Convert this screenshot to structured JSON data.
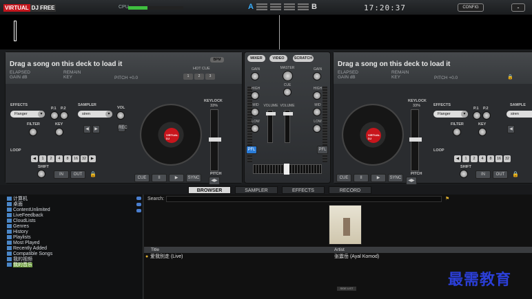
{
  "topbar": {
    "logo_a": "VIRTUAL",
    "logo_b": "DJ FREE",
    "cpu_label": "CPU",
    "cpu_level": 0.35,
    "deck_a": "A",
    "deck_b": "B",
    "clock": "17:20:37",
    "config": "CONFIG",
    "minimize": "-"
  },
  "deck_left": {
    "title": "Drag a song on this deck to load it",
    "elapsed": "ELAPSED",
    "remain": "REMAIN",
    "gain": "GAIN dB",
    "key": "KEY",
    "pitch": "PITCH +0.0",
    "bpm": "BPM",
    "hotcue": "HOT CUE",
    "hotcues": [
      "1",
      "2",
      "3"
    ],
    "effects": "EFFECTS",
    "effect_value": "Flanger",
    "p1": "P.1",
    "p2": "P.2",
    "sampler": "SAMPLER",
    "sampler_value": "siren",
    "vol": "VOL",
    "filter": "FILTER",
    "key2": "KEY",
    "rec": "REC",
    "loop": "LOOP",
    "loops": [
      "1",
      "2",
      "4",
      "8",
      "16",
      "32"
    ],
    "shift": "SHIFT",
    "in": "IN",
    "out": "OUT",
    "keylock": "KEYLOCK",
    "keylock_pct": "33%",
    "pitch_lbl": "PITCH",
    "cue": "CUE",
    "pause": "II",
    "play": "▶",
    "sync": "SYNC",
    "label_text": "VIRTUAL DJ"
  },
  "deck_right": {
    "title": "Drag a song on this deck to load it",
    "elapsed": "ELAPSED",
    "remain": "REMAIN",
    "gain": "GAIN dB",
    "key": "KEY",
    "pitch": "PITCH +0.0",
    "effects": "EFFECTS",
    "effect_value": "Flanger",
    "p1": "P.1",
    "p2": "P.2",
    "sampler": "SAMPLE",
    "sampler_value": "siren",
    "filter": "FILTER",
    "key2": "KEY",
    "loop": "LOOP",
    "loops": [
      "1",
      "2",
      "4",
      "8",
      "16",
      "32"
    ],
    "shift": "SHIFT",
    "in": "IN",
    "out": "OUT",
    "keylock": "KEYLOCK",
    "keylock_pct": "33%",
    "pitch_lbl": "PITCH",
    "cue": "CUE",
    "pause": "II",
    "play": "▶",
    "sync": "SYNC",
    "label_text": "VIRTUAL DJ"
  },
  "mixer": {
    "tabs": [
      "MIXER",
      "VIDEO",
      "SCRATCH"
    ],
    "gain": "GAIN",
    "master": "MASTER",
    "cue": "CUE",
    "high": "HIGH",
    "mid": "MID",
    "low": "LOW",
    "volume": "VOLUME",
    "pfl": "PFL"
  },
  "browser_tabs": [
    "BROWSER",
    "SAMPLER",
    "EFFECTS",
    "RECORD"
  ],
  "tree": [
    "计算机",
    "桌面",
    "ContentUnlimited",
    "LiveFeedback",
    "CloudLists",
    "Genres",
    "History",
    "Playlists",
    "Most Played",
    "Recently Added",
    "Compatible Songs",
    "我的视频",
    "我的音乐"
  ],
  "search": {
    "label": "Search:",
    "value": ""
  },
  "columns": {
    "title": "Title",
    "artist": "Artist"
  },
  "tracks": [
    {
      "title": "爱我别走 (Live)",
      "artist": "张震岳 (Ayal Komod)"
    }
  ],
  "side_list": "SIDE LIST",
  "watermark": "最需教育"
}
